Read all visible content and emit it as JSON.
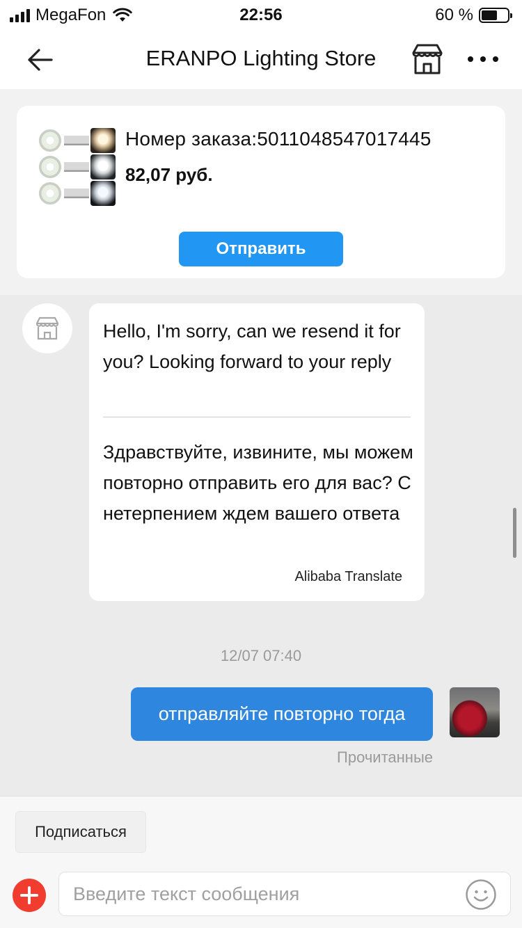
{
  "status_bar": {
    "carrier": "MegaFon",
    "time": "22:56",
    "battery": "60 %"
  },
  "header": {
    "title": "ERANPO Lighting Store",
    "icons": [
      "back-arrow-icon",
      "store-icon",
      "more-icon"
    ]
  },
  "order": {
    "number_text": "Номер заказа:5011048547017445",
    "price": "82,07 руб.",
    "send_label": "Отправить"
  },
  "chat": {
    "incoming": {
      "original": "Hello, I'm sorry, can we resend it for you? Looking forward to your reply",
      "translated": "Здравствуйте, извините, мы можем повторно отправить его для вас? С нетерпением ждем вашего ответа",
      "provider": "Alibaba Translate"
    },
    "timestamp": "12/07 07:40",
    "outgoing": {
      "text": "отправляйте повторно тогда",
      "status": "Прочитанные"
    }
  },
  "footer": {
    "subscribe_label": "Подписаться",
    "input_placeholder": "Введите текст сообщения"
  },
  "colors": {
    "accent": "#2196f3",
    "outgoing_bubble": "#2e86de",
    "plus_button": "#f03d2f",
    "chat_background": "#ebebeb"
  }
}
